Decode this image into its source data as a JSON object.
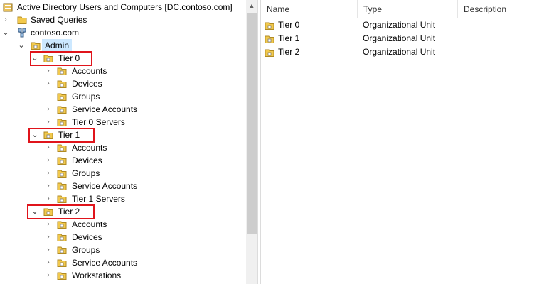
{
  "tree": {
    "root_title": "Active Directory Users and Computers [DC.contoso.com]",
    "saved_queries": "Saved Queries",
    "domain": "contoso.com",
    "admin": "Admin",
    "tiers": [
      {
        "label": "Tier 0",
        "children": [
          "Accounts",
          "Devices",
          "Groups",
          "Service Accounts",
          "Tier 0 Servers"
        ]
      },
      {
        "label": "Tier 1",
        "children": [
          "Accounts",
          "Devices",
          "Groups",
          "Service Accounts",
          "Tier 1 Servers"
        ]
      },
      {
        "label": "Tier 2",
        "children": [
          "Accounts",
          "Devices",
          "Groups",
          "Service Accounts",
          "Workstations"
        ]
      }
    ]
  },
  "list": {
    "columns": {
      "name": "Name",
      "type": "Type",
      "description": "Description"
    },
    "rows": [
      {
        "name": "Tier 0",
        "type": "Organizational Unit",
        "description": ""
      },
      {
        "name": "Tier 1",
        "type": "Organizational Unit",
        "description": ""
      },
      {
        "name": "Tier 2",
        "type": "Organizational Unit",
        "description": ""
      }
    ]
  },
  "colors": {
    "highlight": "#e0141b",
    "selection": "#cce8ff",
    "folder": "#f2c94c"
  },
  "icons": {
    "folder": "folder-icon",
    "ou": "ou-folder-icon",
    "domain": "domain-icon",
    "root": "ad-console-icon"
  }
}
